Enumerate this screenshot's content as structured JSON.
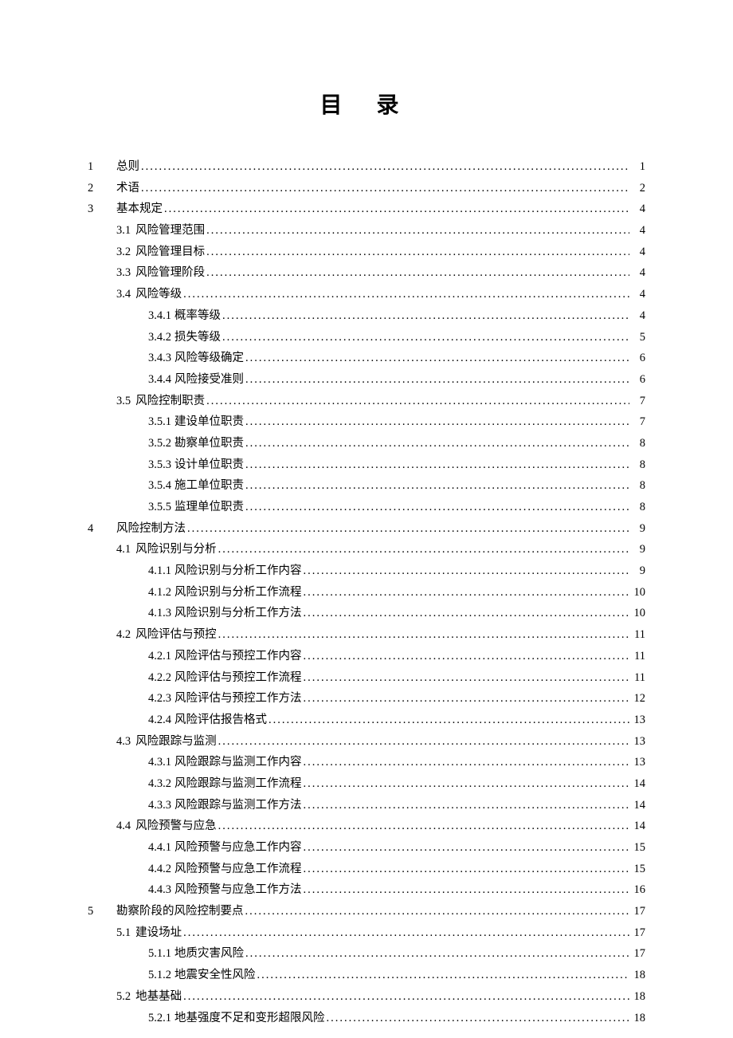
{
  "title": "目 录",
  "entries": [
    {
      "level": 1,
      "chapter": "1",
      "label": "",
      "text": "总则",
      "page": "1"
    },
    {
      "level": 1,
      "chapter": "2",
      "label": "",
      "text": "术语",
      "page": "2"
    },
    {
      "level": 1,
      "chapter": "3",
      "label": "",
      "text": "基本规定",
      "page": "4"
    },
    {
      "level": 2,
      "chapter": "",
      "label": "3.1",
      "text": "风险管理范围",
      "page": "4"
    },
    {
      "level": 2,
      "chapter": "",
      "label": "3.2",
      "text": "风险管理目标",
      "page": "4"
    },
    {
      "level": 2,
      "chapter": "",
      "label": "3.3",
      "text": "风险管理阶段",
      "page": "4"
    },
    {
      "level": 2,
      "chapter": "",
      "label": "3.4",
      "text": "风险等级",
      "page": "4"
    },
    {
      "level": 3,
      "chapter": "",
      "label": "3.4.1",
      "text": "概率等级",
      "page": "4"
    },
    {
      "level": 3,
      "chapter": "",
      "label": "3.4.2",
      "text": "损失等级",
      "page": "5"
    },
    {
      "level": 3,
      "chapter": "",
      "label": "3.4.3",
      "text": "风险等级确定",
      "page": "6"
    },
    {
      "level": 3,
      "chapter": "",
      "label": "3.4.4",
      "text": "风险接受准则",
      "page": "6"
    },
    {
      "level": 2,
      "chapter": "",
      "label": "3.5",
      "text": "风险控制职责",
      "page": "7"
    },
    {
      "level": 3,
      "chapter": "",
      "label": "3.5.1",
      "text": "建设单位职责",
      "page": "7"
    },
    {
      "level": 3,
      "chapter": "",
      "label": "3.5.2",
      "text": "勘察单位职责",
      "page": "8"
    },
    {
      "level": 3,
      "chapter": "",
      "label": "3.5.3",
      "text": "设计单位职责",
      "page": "8"
    },
    {
      "level": 3,
      "chapter": "",
      "label": "3.5.4",
      "text": "施工单位职责",
      "page": "8"
    },
    {
      "level": 3,
      "chapter": "",
      "label": "3.5.5",
      "text": "监理单位职责",
      "page": "8"
    },
    {
      "level": 1,
      "chapter": "4",
      "label": "",
      "text": "风险控制方法",
      "page": "9"
    },
    {
      "level": 2,
      "chapter": "",
      "label": "4.1",
      "text": "风险识别与分析",
      "page": "9"
    },
    {
      "level": 3,
      "chapter": "",
      "label": "4.1.1",
      "text": "风险识别与分析工作内容",
      "page": "9"
    },
    {
      "level": 3,
      "chapter": "",
      "label": "4.1.2",
      "text": "风险识别与分析工作流程",
      "page": "10"
    },
    {
      "level": 3,
      "chapter": "",
      "label": "4.1.3",
      "text": "风险识别与分析工作方法",
      "page": "10"
    },
    {
      "level": 2,
      "chapter": "",
      "label": "4.2",
      "text": "风险评估与预控",
      "page": "11"
    },
    {
      "level": 3,
      "chapter": "",
      "label": "4.2.1",
      "text": "风险评估与预控工作内容",
      "page": "11"
    },
    {
      "level": 3,
      "chapter": "",
      "label": "4.2.2",
      "text": "风险评估与预控工作流程",
      "page": "11"
    },
    {
      "level": 3,
      "chapter": "",
      "label": "4.2.3",
      "text": "风险评估与预控工作方法",
      "page": "12"
    },
    {
      "level": 3,
      "chapter": "",
      "label": "4.2.4",
      "text": "风险评估报告格式",
      "page": "13"
    },
    {
      "level": 2,
      "chapter": "",
      "label": "4.3",
      "text": "风险跟踪与监测",
      "page": "13"
    },
    {
      "level": 3,
      "chapter": "",
      "label": "4.3.1",
      "text": "风险跟踪与监测工作内容",
      "page": "13"
    },
    {
      "level": 3,
      "chapter": "",
      "label": "4.3.2",
      "text": "风险跟踪与监测工作流程",
      "page": "14"
    },
    {
      "level": 3,
      "chapter": "",
      "label": "4.3.3",
      "text": "风险跟踪与监测工作方法",
      "page": "14"
    },
    {
      "level": 2,
      "chapter": "",
      "label": "4.4",
      "text": "风险预警与应急",
      "page": "14"
    },
    {
      "level": 3,
      "chapter": "",
      "label": "4.4.1",
      "text": "风险预警与应急工作内容",
      "page": "15"
    },
    {
      "level": 3,
      "chapter": "",
      "label": "4.4.2",
      "text": "风险预警与应急工作流程",
      "page": "15"
    },
    {
      "level": 3,
      "chapter": "",
      "label": "4.4.3",
      "text": "风险预警与应急工作方法",
      "page": "16"
    },
    {
      "level": 1,
      "chapter": "5",
      "label": "",
      "text": "勘察阶段的风险控制要点",
      "page": "17"
    },
    {
      "level": 2,
      "chapter": "",
      "label": "5.1",
      "text": "建设场址",
      "page": "17"
    },
    {
      "level": 3,
      "chapter": "",
      "label": "5.1.1",
      "text": "地质灾害风险",
      "page": "17"
    },
    {
      "level": 3,
      "chapter": "",
      "label": "5.1.2",
      "text": "地震安全性风险",
      "page": "18"
    },
    {
      "level": 2,
      "chapter": "",
      "label": "5.2",
      "text": "地基基础",
      "page": "18"
    },
    {
      "level": 3,
      "chapter": "",
      "label": "5.2.1",
      "text": "地基强度不足和变形超限风险",
      "page": "18"
    }
  ]
}
